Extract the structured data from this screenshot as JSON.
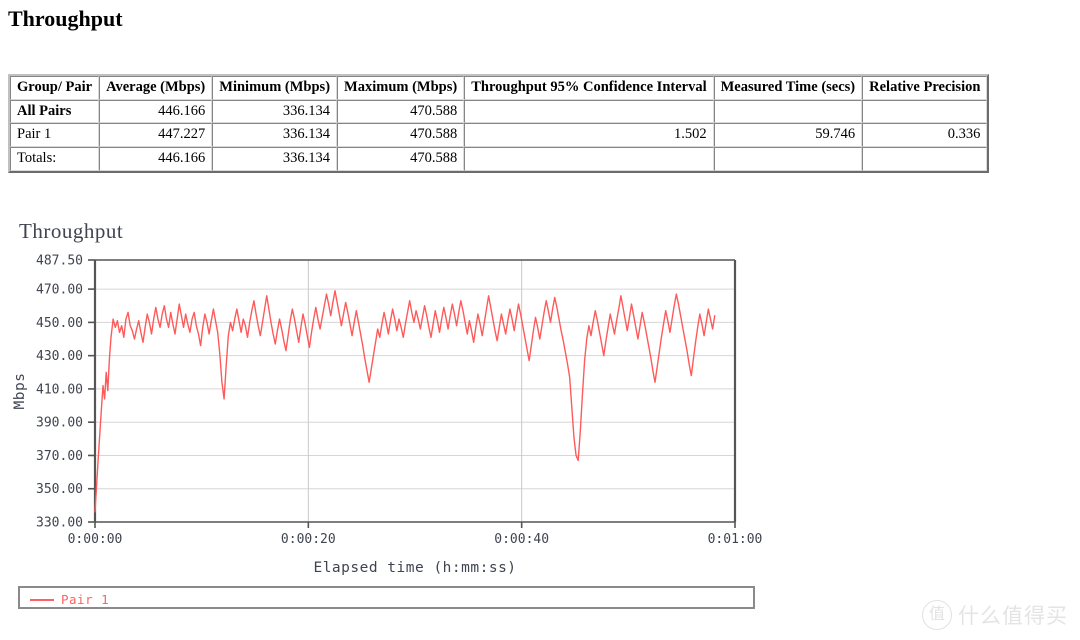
{
  "page": {
    "title": "Throughput"
  },
  "table": {
    "columns": [
      "Group/ Pair",
      "Average (Mbps)",
      "Minimum (Mbps)",
      "Maximum (Mbps)",
      "Throughput 95% Confidence Interval",
      "Measured Time (secs)",
      "Relative Precision"
    ],
    "rows": [
      {
        "label": "All Pairs",
        "bold": true,
        "average": "446.166",
        "minimum": "336.134",
        "maximum": "470.588",
        "confidence_interval": "",
        "measured_time": "",
        "relative_precision": ""
      },
      {
        "label": "Pair 1",
        "bold": false,
        "average": "447.227",
        "minimum": "336.134",
        "maximum": "470.588",
        "confidence_interval": "1.502",
        "measured_time": "59.746",
        "relative_precision": "0.336"
      },
      {
        "label": "Totals:",
        "bold": false,
        "average": "446.166",
        "minimum": "336.134",
        "maximum": "470.588",
        "confidence_interval": "",
        "measured_time": "",
        "relative_precision": ""
      }
    ]
  },
  "chart_data": {
    "type": "line",
    "title": "Throughput",
    "xlabel": "Elapsed time (h:mm:ss)",
    "ylabel": "Mbps",
    "grid": true,
    "legend_position": "bottom",
    "line_color": "#ff5a5a",
    "ylim": [
      330.0,
      487.5
    ],
    "xlim": [
      0,
      60
    ],
    "ytick_labels": [
      "487.50",
      "470.00",
      "450.00",
      "430.00",
      "410.00",
      "390.00",
      "370.00",
      "350.00",
      "330.00"
    ],
    "ytick_values": [
      487.5,
      470.0,
      450.0,
      430.0,
      410.0,
      390.0,
      370.0,
      350.0,
      330.0
    ],
    "xtick_labels": [
      "0:00:00",
      "0:00:20",
      "0:00:40",
      "0:01:00"
    ],
    "xtick_values": [
      0,
      20,
      40,
      60
    ],
    "series": [
      {
        "name": "Pair 1",
        "color": "#ff5a5a",
        "x": [
          0.0,
          0.15,
          0.3,
          0.45,
          0.6,
          0.75,
          0.9,
          1.05,
          1.2,
          1.35,
          1.5,
          1.7,
          1.9,
          2.1,
          2.3,
          2.5,
          2.7,
          2.9,
          3.1,
          3.3,
          3.5,
          3.7,
          3.9,
          4.1,
          4.3,
          4.5,
          4.7,
          4.9,
          5.1,
          5.3,
          5.5,
          5.7,
          5.9,
          6.1,
          6.3,
          6.5,
          6.7,
          6.9,
          7.1,
          7.3,
          7.5,
          7.7,
          7.9,
          8.1,
          8.3,
          8.5,
          8.7,
          8.9,
          9.1,
          9.3,
          9.5,
          9.7,
          9.9,
          10.1,
          10.3,
          10.5,
          10.7,
          10.9,
          11.1,
          11.3,
          11.5,
          11.7,
          11.9,
          12.1,
          12.3,
          12.5,
          12.7,
          12.9,
          13.1,
          13.3,
          13.5,
          13.7,
          13.9,
          14.1,
          14.3,
          14.5,
          14.7,
          14.9,
          15.1,
          15.3,
          15.5,
          15.7,
          15.9,
          16.1,
          16.3,
          16.5,
          16.7,
          16.9,
          17.1,
          17.3,
          17.5,
          17.7,
          17.9,
          18.1,
          18.3,
          18.5,
          18.7,
          18.9,
          19.1,
          19.3,
          19.5,
          19.7,
          19.9,
          20.1,
          20.3,
          20.5,
          20.7,
          20.9,
          21.1,
          21.3,
          21.5,
          21.7,
          21.9,
          22.1,
          22.3,
          22.5,
          22.7,
          22.9,
          23.1,
          23.3,
          23.5,
          23.7,
          23.9,
          24.1,
          24.3,
          24.5,
          24.7,
          24.9,
          25.1,
          25.3,
          25.5,
          25.7,
          25.9,
          26.1,
          26.3,
          26.5,
          26.7,
          26.9,
          27.1,
          27.3,
          27.5,
          27.7,
          27.9,
          28.1,
          28.3,
          28.5,
          28.7,
          28.9,
          29.1,
          29.3,
          29.5,
          29.7,
          29.9,
          30.1,
          30.3,
          30.5,
          30.7,
          30.9,
          31.1,
          31.3,
          31.5,
          31.7,
          31.9,
          32.1,
          32.3,
          32.5,
          32.7,
          32.9,
          33.1,
          33.3,
          33.5,
          33.7,
          33.9,
          34.1,
          34.3,
          34.5,
          34.7,
          34.9,
          35.1,
          35.3,
          35.5,
          35.7,
          35.9,
          36.1,
          36.3,
          36.5,
          36.7,
          36.9,
          37.1,
          37.3,
          37.5,
          37.7,
          37.9,
          38.1,
          38.3,
          38.5,
          38.7,
          38.9,
          39.1,
          39.3,
          39.5,
          39.7,
          39.9,
          40.1,
          40.3,
          40.5,
          40.7,
          40.9,
          41.1,
          41.3,
          41.5,
          41.7,
          41.9,
          42.1,
          42.3,
          42.5,
          42.7,
          42.9,
          43.1,
          43.3,
          43.5,
          43.7,
          43.9,
          44.1,
          44.3,
          44.5,
          44.7,
          44.9,
          45.1,
          45.3,
          45.5,
          45.7,
          45.9,
          46.1,
          46.3,
          46.5,
          46.7,
          46.9,
          47.1,
          47.3,
          47.5,
          47.7,
          47.9,
          48.1,
          48.3,
          48.5,
          48.7,
          48.9,
          49.1,
          49.3,
          49.5,
          49.7,
          49.9,
          50.1,
          50.3,
          50.5,
          50.7,
          50.9,
          51.1,
          51.3,
          51.5,
          51.7,
          51.9,
          52.1,
          52.3,
          52.5,
          52.7,
          52.9,
          53.1,
          53.3,
          53.5,
          53.7,
          53.9,
          54.1,
          54.3,
          54.5,
          54.7,
          54.9,
          55.1,
          55.3,
          55.5,
          55.7,
          55.9,
          56.1,
          56.3,
          56.5,
          56.7,
          56.9,
          57.1,
          57.3,
          57.5,
          57.7,
          57.9,
          58.1,
          58.3,
          58.5,
          58.7,
          58.9,
          59.1,
          59.3,
          59.5,
          59.746
        ],
        "y": [
          336.134,
          352.0,
          368.0,
          383.0,
          398.0,
          412.0,
          404.0,
          420.0,
          409.0,
          428.0,
          441.0,
          452.0,
          447.0,
          451.0,
          444.0,
          448.0,
          441.0,
          452.0,
          456.0,
          448.0,
          445.0,
          440.0,
          446.0,
          451.0,
          444.0,
          438.0,
          447.0,
          455.0,
          450.0,
          443.0,
          452.0,
          459.0,
          452.0,
          447.0,
          455.0,
          460.0,
          452.0,
          447.0,
          456.0,
          449.0,
          443.0,
          452.0,
          461.0,
          454.0,
          447.0,
          455.0,
          449.0,
          444.0,
          452.0,
          456.0,
          448.0,
          443.0,
          436.0,
          447.0,
          455.0,
          450.0,
          443.0,
          451.0,
          458.0,
          451.0,
          444.0,
          431.0,
          414.0,
          404.0,
          424.0,
          442.0,
          450.0,
          445.0,
          452.0,
          458.0,
          451.0,
          444.0,
          452.0,
          448.0,
          441.0,
          450.0,
          457.0,
          463.0,
          455.0,
          448.0,
          442.0,
          450.0,
          458.0,
          466.0,
          458.0,
          450.0,
          443.0,
          437.0,
          445.0,
          452.0,
          446.0,
          439.0,
          433.0,
          442.0,
          451.0,
          458.0,
          452.0,
          445.0,
          438.0,
          447.0,
          455.0,
          449.0,
          442.0,
          435.0,
          444.0,
          452.0,
          459.0,
          452.0,
          446.0,
          453.0,
          460.0,
          467.0,
          461.0,
          454.0,
          462.0,
          469.0,
          462.0,
          455.0,
          448.0,
          455.0,
          462.0,
          456.0,
          449.0,
          442.0,
          450.0,
          457.0,
          450.0,
          443.0,
          436.0,
          428.0,
          421.0,
          414.0,
          422.0,
          430.0,
          438.0,
          446.0,
          441.0,
          449.0,
          456.0,
          450.0,
          443.0,
          451.0,
          458.0,
          452.0,
          445.0,
          452.0,
          447.0,
          441.0,
          449.0,
          456.0,
          463.0,
          456.0,
          450.0,
          457.0,
          452.0,
          446.0,
          453.0,
          460.0,
          454.0,
          447.0,
          441.0,
          449.0,
          457.0,
          451.0,
          444.0,
          452.0,
          459.0,
          453.0,
          446.0,
          454.0,
          461.0,
          455.0,
          448.0,
          456.0,
          463.0,
          457.0,
          450.0,
          443.0,
          451.0,
          445.0,
          438.0,
          447.0,
          455.0,
          449.0,
          442.0,
          450.0,
          458.0,
          466.0,
          459.0,
          452.0,
          445.0,
          439.0,
          447.0,
          455.0,
          449.0,
          443.0,
          451.0,
          458.0,
          452.0,
          445.0,
          453.0,
          461.0,
          455.0,
          448.0,
          441.0,
          434.0,
          427.0,
          436.0,
          445.0,
          453.0,
          447.0,
          440.0,
          448.0,
          456.0,
          463.0,
          457.0,
          450.0,
          458.0,
          465.0,
          459.0,
          452.0,
          445.0,
          439.0,
          432.0,
          425.0,
          417.0,
          399.0,
          381.0,
          370.0,
          367.0,
          385.0,
          407.0,
          427.0,
          440.0,
          448.0,
          442.0,
          450.0,
          457.0,
          451.0,
          444.0,
          437.0,
          430.0,
          439.0,
          447.0,
          455.0,
          449.0,
          443.0,
          451.0,
          458.0,
          466.0,
          459.0,
          452.0,
          445.0,
          453.0,
          461.0,
          454.0,
          447.0,
          440.0,
          448.0,
          456.0,
          450.0,
          443.0,
          436.0,
          429.0,
          421.0,
          414.0,
          423.0,
          432.0,
          441.0,
          449.0,
          457.0,
          451.0,
          444.0,
          452.0,
          460.0,
          467.0,
          461.0,
          454.0,
          447.0,
          440.0,
          433.0,
          425.0,
          418.0,
          428.0,
          438.0,
          447.0,
          455.0,
          449.0,
          442.0,
          450.0,
          458.0,
          452.0,
          446.0,
          454.0
        ]
      }
    ]
  },
  "legend": {
    "entries": [
      {
        "label": "Pair 1",
        "color": "#ff6161"
      }
    ]
  },
  "watermark": {
    "mark": "值",
    "text": "什么值得买"
  }
}
